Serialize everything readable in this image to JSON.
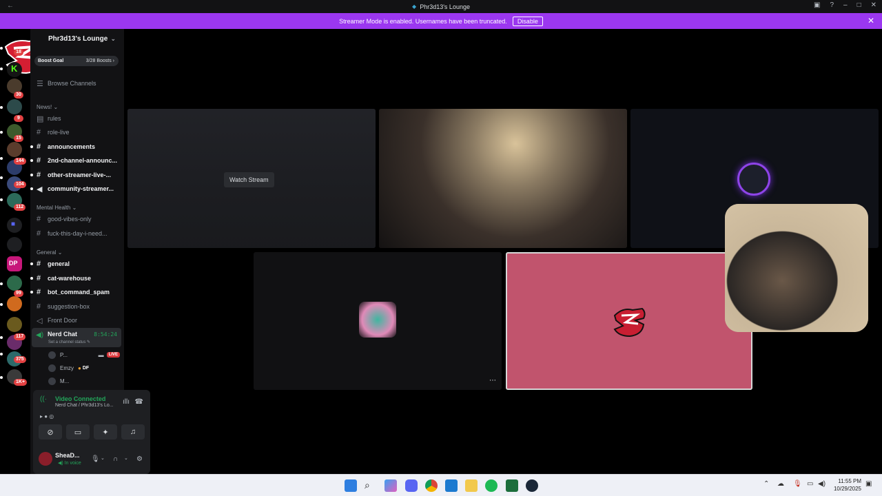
{
  "window": {
    "title": "Phr3d13's Lounge"
  },
  "banner": {
    "message": "Streamer Mode is enabled. Usernames have been truncated.",
    "button": "Disable"
  },
  "rail": {
    "badges": [
      "18",
      "30",
      "9",
      "15",
      "144",
      "104",
      "112",
      "99",
      "117",
      "375",
      "1K+"
    ]
  },
  "server": {
    "name": "Phr3d13's Lounge",
    "boost_goal": "Boost Goal",
    "boost_count": "3/28 Boosts",
    "browse": "Browse Channels"
  },
  "categories": {
    "news": "News!",
    "mental": "Mental Health",
    "general": "General"
  },
  "channels": {
    "rules": "rules",
    "role_live": "role-live",
    "announcements": "announcements",
    "second": "2nd-channel-announc...",
    "other": "other-streamer-live-...",
    "community": "community-streamer...",
    "good": "good-vibes-only",
    "fuck": "fuck-this-day-i-need...",
    "general": "general",
    "cat": "cat-warehouse",
    "bot": "bot_command_spam",
    "suggestion": "suggestion-box",
    "front": "Front Door"
  },
  "voice_channel": {
    "name": "Nerd Chat",
    "timer": "8:54:24",
    "status": "Set a channel status",
    "users": [
      {
        "name": "P...",
        "live": "LIVE"
      },
      {
        "name": "Emzy",
        "tag": "DF"
      },
      {
        "name": "M..."
      }
    ]
  },
  "voice_panel": {
    "status": "Video Connected",
    "location": "Nerd Chat / Phr3d13's Lo..."
  },
  "user": {
    "name": "SheaD...",
    "status": "In voice"
  },
  "stage": {
    "watch_stream": "Watch Stream"
  },
  "taskbar": {
    "time": "11:55 PM",
    "date": "10/29/2025"
  },
  "colors": {
    "accent": "#9b37f0",
    "online": "#23a55a",
    "live": "#da373c"
  }
}
